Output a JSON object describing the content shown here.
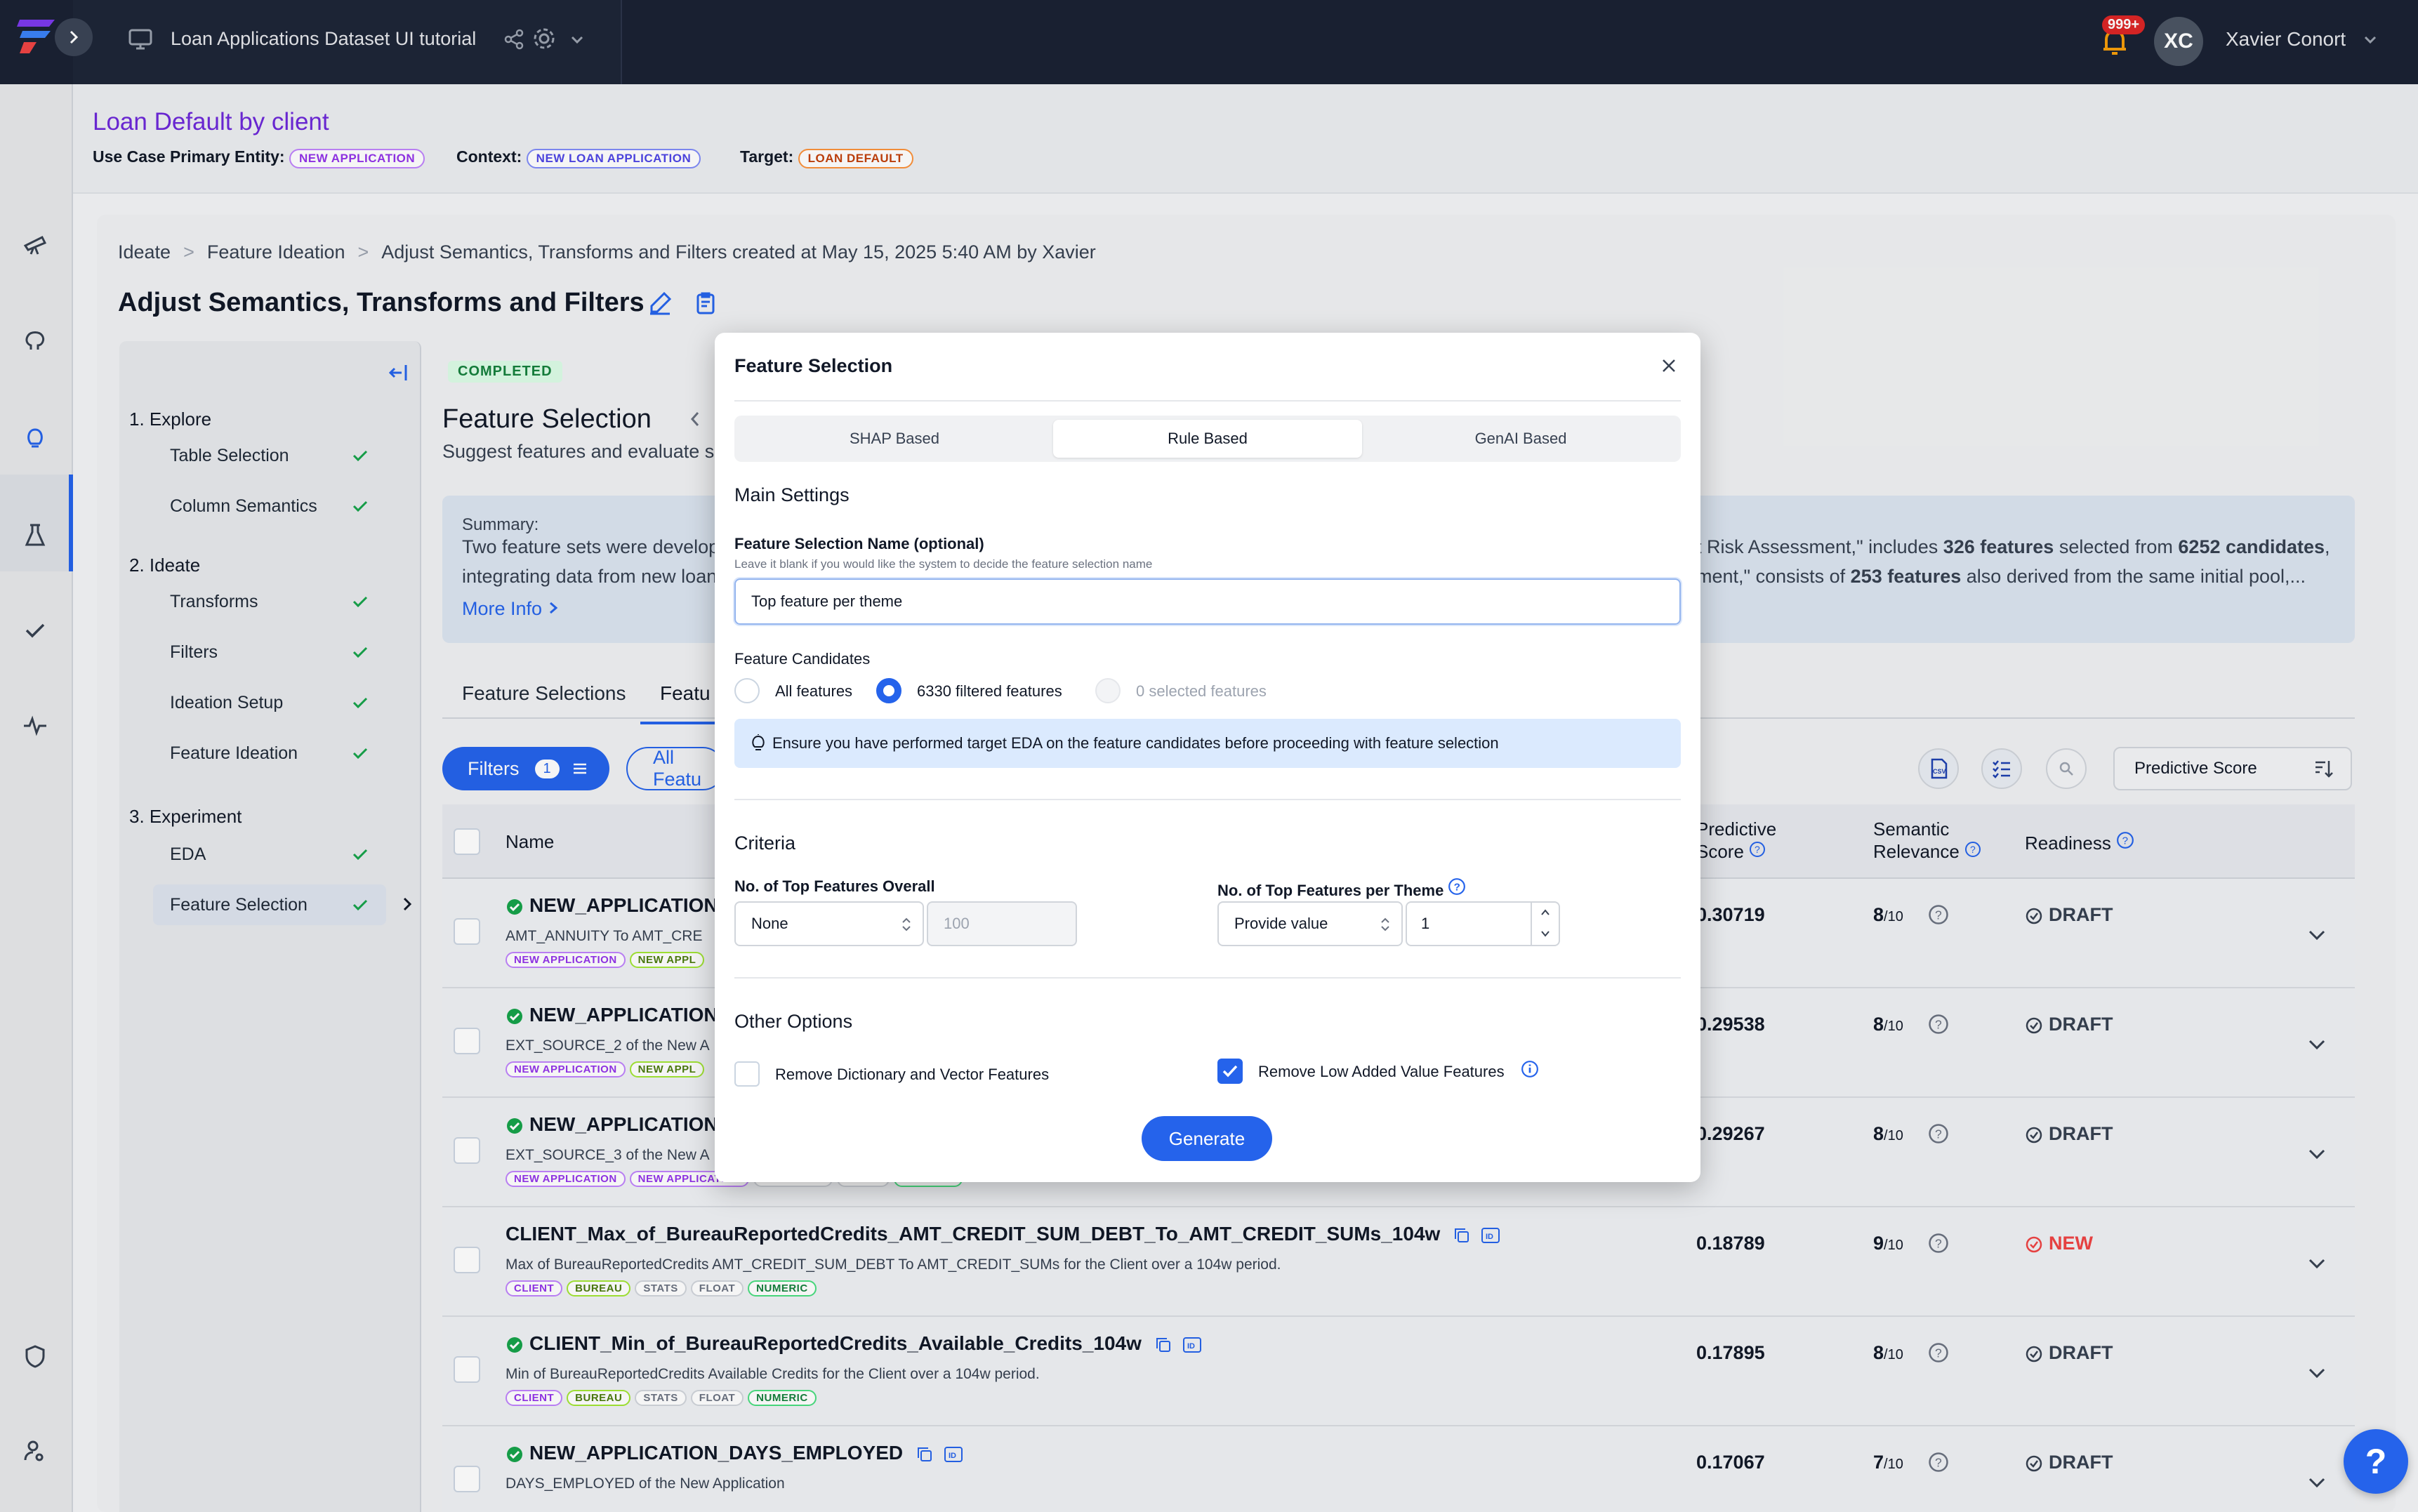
{
  "topbar": {
    "workspace_title": "Loan Applications Dataset UI tutorial",
    "notifications": "999+",
    "avatar_initials": "XC",
    "user_name": "Xavier Conort"
  },
  "project": {
    "title": "Loan Default by client",
    "primary_entity_label": "Use Case Primary Entity:",
    "primary_entity": "NEW APPLICATION",
    "context_label": "Context:",
    "context": "NEW LOAN APPLICATION",
    "target_label": "Target:",
    "target": "LOAN DEFAULT"
  },
  "breadcrumb": {
    "items": [
      "Ideate",
      "Feature Ideation",
      "Adjust Semantics, Transforms and Filters created at May 15, 2025 5:40 AM by Xavier"
    ],
    "sep": ">"
  },
  "page": {
    "title": "Adjust Semantics, Transforms and Filters"
  },
  "steps": {
    "sections": [
      {
        "title": "1. Explore",
        "items": [
          "Table Selection",
          "Column Semantics"
        ]
      },
      {
        "title": "2. Ideate",
        "items": [
          "Transforms",
          "Filters",
          "Ideation Setup",
          "Feature Ideation"
        ]
      },
      {
        "title": "3. Experiment",
        "items": [
          "EDA",
          "Feature Selection"
        ]
      }
    ]
  },
  "feature_selection": {
    "status": "COMPLETED",
    "title": "Feature Selection",
    "subtitle": "Suggest features and evaluate s",
    "summary_label": "Summary:",
    "summary_l1": "Two feature sets were develop",
    "summary_l2": "integrating data from new loan",
    "summary_r1_a": "t Risk Assessment,\" includes ",
    "summary_r1_b": "326 features",
    "summary_r1_c": " selected from ",
    "summary_r1_d": "6252 candidates",
    "summary_r1_e": ",",
    "summary_r2_a": "ment,\" consists of ",
    "summary_r2_b": "253 features",
    "summary_r2_c": " also derived from the same initial pool,...",
    "more_info": "More Info",
    "tabs": [
      "Feature Selections",
      "Featu"
    ],
    "filters_label": "Filters",
    "filters_count": "1",
    "all_features_label": "All Featu",
    "sort_value": "Predictive Score"
  },
  "table": {
    "headers": {
      "name": "Name",
      "predictive_score_1": "Predictive",
      "predictive_score_2": "Score",
      "semantic_1": "Semantic",
      "semantic_2": "Relevance",
      "readiness": "Readiness"
    },
    "rows": [
      {
        "name": "NEW_APPLICATION_A",
        "desc": "AMT_ANNUITY To AMT_CRE",
        "tags": [
          "NEW APPLICATION",
          "NEW APPL"
        ],
        "score": "0.30719",
        "sem": "8",
        "ready": "DRAFT"
      },
      {
        "name": "NEW_APPLICATION_E",
        "desc": "EXT_SOURCE_2 of the New A",
        "tags": [
          "NEW APPLICATION",
          "NEW APPL"
        ],
        "score": "0.29538",
        "sem": "8",
        "ready": "DRAFT"
      },
      {
        "name": "NEW_APPLICATION_E",
        "desc": "EXT_SOURCE_3 of the New A",
        "tags": [
          "NEW APPLICATION",
          "NEW APPLICATION",
          "ATTRIBUTE",
          "FLOAT",
          "NUMERIC"
        ],
        "score": "0.29267",
        "sem": "8",
        "ready": "DRAFT"
      },
      {
        "name": "CLIENT_Max_of_BureauReportedCredits_AMT_CREDIT_SUM_DEBT_To_AMT_CREDIT_SUMs_104w",
        "desc": "Max of BureauReportedCredits AMT_CREDIT_SUM_DEBT To AMT_CREDIT_SUMs for the Client over a 104w period.",
        "tags": [
          "CLIENT",
          "BUREAU",
          "STATS",
          "FLOAT",
          "NUMERIC"
        ],
        "score": "0.18789",
        "sem": "9",
        "ready": "NEW"
      },
      {
        "name": "CLIENT_Min_of_BureauReportedCredits_Available_Credits_104w",
        "desc": "Min of BureauReportedCredits Available Credits for the Client over a 104w period.",
        "tags": [
          "CLIENT",
          "BUREAU",
          "STATS",
          "FLOAT",
          "NUMERIC"
        ],
        "score": "0.17895",
        "sem": "8",
        "ready": "DRAFT"
      },
      {
        "name": "NEW_APPLICATION_DAYS_EMPLOYED",
        "desc": "DAYS_EMPLOYED of the New Application",
        "tags": [],
        "score": "0.17067",
        "sem": "7",
        "ready": "DRAFT"
      }
    ],
    "sem_suffix": "/10"
  },
  "modal": {
    "title": "Feature Selection",
    "tabs": [
      "SHAP Based",
      "Rule Based",
      "GenAI Based"
    ],
    "main_settings": "Main Settings",
    "name_label": "Feature Selection Name (optional)",
    "name_help": "Leave it blank if you would like the system to decide the feature selection name",
    "name_value": "Top feature per theme",
    "candidates_label": "Feature Candidates",
    "radio_all": "All features",
    "radio_filtered": "6330 filtered features",
    "radio_selected": "0 selected features",
    "info": "Ensure you have performed target EDA on the feature candidates before proceeding with feature selection",
    "criteria": "Criteria",
    "top_overall_label": "No. of Top Features Overall",
    "top_overall_select": "None",
    "top_overall_value": "100",
    "top_theme_label": "No. of Top Features per Theme",
    "top_theme_select": "Provide value",
    "top_theme_value": "1",
    "other_options": "Other Options",
    "remove_dict": "Remove Dictionary and Vector Features",
    "remove_low": "Remove Low Added Value Features",
    "generate": "Generate"
  },
  "help_button": "?",
  "colors": {
    "accent": "#2563eb",
    "topbar": "#1b2233",
    "project_title": "#6d28d9"
  }
}
